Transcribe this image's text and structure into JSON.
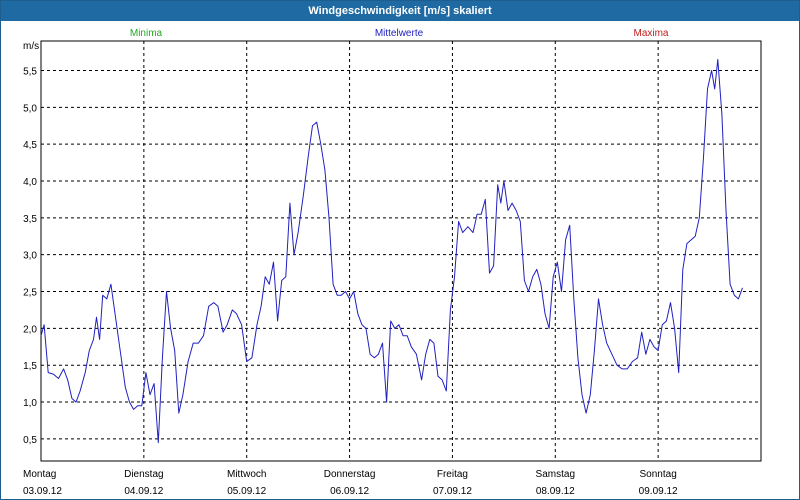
{
  "window": {
    "title": "Windgeschwindigkeit [m/s] skaliert"
  },
  "legend": {
    "min": {
      "label": "Minima",
      "color": "#22aa22"
    },
    "mean": {
      "label": "Mittelwerte",
      "color": "#2020c0"
    },
    "max": {
      "label": "Maxima",
      "color": "#c02020"
    }
  },
  "chart_data": {
    "type": "line",
    "title": "Windgeschwindigkeit [m/s] skaliert",
    "ylabel": "m/s",
    "xlabel": "",
    "ylim": [
      0.2,
      5.9
    ],
    "yticks": [
      "0,5",
      "1,0",
      "1,5",
      "2,0",
      "2,5",
      "3,0",
      "3,5",
      "4,0",
      "4,5",
      "5,0",
      "5,5"
    ],
    "ytick_values": [
      0.5,
      1.0,
      1.5,
      2.0,
      2.5,
      3.0,
      3.5,
      4.0,
      4.5,
      5.0,
      5.5
    ],
    "xlim_days": [
      0,
      7
    ],
    "xticks": [
      {
        "day": "Montag",
        "date": "03.09.12"
      },
      {
        "day": "Dienstag",
        "date": "04.09.12"
      },
      {
        "day": "Mittwoch",
        "date": "05.09.12"
      },
      {
        "day": "Donnerstag",
        "date": "06.09.12"
      },
      {
        "day": "Freitag",
        "date": "07.09.12"
      },
      {
        "day": "Samstag",
        "date": "08.09.12"
      },
      {
        "day": "Sonntag",
        "date": "09.09.12"
      }
    ],
    "grid": true,
    "series": [
      {
        "name": "Mittelwerte",
        "color": "#2020c0",
        "points": [
          [
            0.0,
            1.9
          ],
          [
            0.03,
            2.05
          ],
          [
            0.07,
            1.4
          ],
          [
            0.12,
            1.38
          ],
          [
            0.17,
            1.32
          ],
          [
            0.22,
            1.45
          ],
          [
            0.26,
            1.3
          ],
          [
            0.3,
            1.05
          ],
          [
            0.34,
            1.0
          ],
          [
            0.38,
            1.15
          ],
          [
            0.43,
            1.4
          ],
          [
            0.47,
            1.7
          ],
          [
            0.51,
            1.85
          ],
          [
            0.54,
            2.15
          ],
          [
            0.57,
            1.85
          ],
          [
            0.6,
            2.45
          ],
          [
            0.64,
            2.4
          ],
          [
            0.68,
            2.6
          ],
          [
            0.71,
            2.3
          ],
          [
            0.75,
            1.9
          ],
          [
            0.78,
            1.6
          ],
          [
            0.82,
            1.2
          ],
          [
            0.86,
            1.0
          ],
          [
            0.9,
            0.9
          ],
          [
            0.94,
            0.95
          ],
          [
            0.98,
            0.95
          ],
          [
            1.02,
            1.4
          ],
          [
            1.06,
            1.1
          ],
          [
            1.1,
            1.25
          ],
          [
            1.14,
            0.45
          ],
          [
            1.18,
            1.6
          ],
          [
            1.22,
            2.5
          ],
          [
            1.26,
            2.0
          ],
          [
            1.3,
            1.7
          ],
          [
            1.34,
            0.85
          ],
          [
            1.38,
            1.1
          ],
          [
            1.43,
            1.55
          ],
          [
            1.48,
            1.8
          ],
          [
            1.53,
            1.8
          ],
          [
            1.58,
            1.9
          ],
          [
            1.63,
            2.3
          ],
          [
            1.68,
            2.35
          ],
          [
            1.72,
            2.3
          ],
          [
            1.77,
            1.95
          ],
          [
            1.81,
            2.05
          ],
          [
            1.86,
            2.25
          ],
          [
            1.9,
            2.2
          ],
          [
            1.95,
            2.05
          ],
          [
            2.0,
            1.55
          ],
          [
            2.05,
            1.6
          ],
          [
            2.1,
            2.05
          ],
          [
            2.14,
            2.3
          ],
          [
            2.18,
            2.7
          ],
          [
            2.22,
            2.6
          ],
          [
            2.26,
            2.9
          ],
          [
            2.3,
            2.1
          ],
          [
            2.34,
            2.65
          ],
          [
            2.38,
            2.7
          ],
          [
            2.42,
            3.7
          ],
          [
            2.46,
            3.0
          ],
          [
            2.5,
            3.3
          ],
          [
            2.55,
            3.8
          ],
          [
            2.6,
            4.35
          ],
          [
            2.64,
            4.75
          ],
          [
            2.68,
            4.8
          ],
          [
            2.72,
            4.5
          ],
          [
            2.76,
            4.15
          ],
          [
            2.8,
            3.5
          ],
          [
            2.84,
            2.6
          ],
          [
            2.88,
            2.45
          ],
          [
            2.92,
            2.45
          ],
          [
            2.96,
            2.5
          ],
          [
            3.0,
            2.4
          ],
          [
            3.04,
            2.5
          ],
          [
            3.08,
            2.2
          ],
          [
            3.12,
            2.05
          ],
          [
            3.16,
            2.0
          ],
          [
            3.2,
            1.65
          ],
          [
            3.24,
            1.6
          ],
          [
            3.28,
            1.65
          ],
          [
            3.32,
            1.8
          ],
          [
            3.36,
            1.0
          ],
          [
            3.4,
            2.1
          ],
          [
            3.44,
            2.0
          ],
          [
            3.48,
            2.05
          ],
          [
            3.52,
            1.9
          ],
          [
            3.56,
            1.9
          ],
          [
            3.6,
            1.75
          ],
          [
            3.65,
            1.65
          ],
          [
            3.7,
            1.3
          ],
          [
            3.74,
            1.65
          ],
          [
            3.78,
            1.85
          ],
          [
            3.82,
            1.8
          ],
          [
            3.86,
            1.35
          ],
          [
            3.9,
            1.3
          ],
          [
            3.94,
            1.15
          ],
          [
            3.98,
            2.25
          ],
          [
            4.02,
            2.7
          ],
          [
            4.06,
            3.45
          ],
          [
            4.1,
            3.3
          ],
          [
            4.15,
            3.38
          ],
          [
            4.2,
            3.3
          ],
          [
            4.24,
            3.55
          ],
          [
            4.28,
            3.55
          ],
          [
            4.32,
            3.75
          ],
          [
            4.36,
            2.75
          ],
          [
            4.4,
            2.85
          ],
          [
            4.44,
            3.95
          ],
          [
            4.47,
            3.7
          ],
          [
            4.5,
            4.0
          ],
          [
            4.54,
            3.6
          ],
          [
            4.58,
            3.7
          ],
          [
            4.62,
            3.6
          ],
          [
            4.66,
            3.45
          ],
          [
            4.7,
            2.65
          ],
          [
            4.74,
            2.5
          ],
          [
            4.78,
            2.7
          ],
          [
            4.82,
            2.8
          ],
          [
            4.86,
            2.6
          ],
          [
            4.9,
            2.2
          ],
          [
            4.94,
            2.0
          ],
          [
            4.98,
            2.7
          ],
          [
            5.02,
            2.9
          ],
          [
            5.06,
            2.5
          ],
          [
            5.1,
            3.2
          ],
          [
            5.14,
            3.4
          ],
          [
            5.18,
            2.4
          ],
          [
            5.22,
            1.6
          ],
          [
            5.26,
            1.1
          ],
          [
            5.3,
            0.85
          ],
          [
            5.34,
            1.1
          ],
          [
            5.38,
            1.7
          ],
          [
            5.42,
            2.4
          ],
          [
            5.46,
            2.05
          ],
          [
            5.5,
            1.8
          ],
          [
            5.55,
            1.65
          ],
          [
            5.6,
            1.5
          ],
          [
            5.65,
            1.45
          ],
          [
            5.7,
            1.45
          ],
          [
            5.75,
            1.55
          ],
          [
            5.8,
            1.6
          ],
          [
            5.84,
            1.95
          ],
          [
            5.88,
            1.65
          ],
          [
            5.92,
            1.85
          ],
          [
            5.96,
            1.75
          ],
          [
            6.0,
            1.7
          ],
          [
            6.04,
            2.05
          ],
          [
            6.08,
            2.1
          ],
          [
            6.12,
            2.35
          ],
          [
            6.16,
            2.0
          ],
          [
            6.2,
            1.4
          ],
          [
            6.24,
            2.8
          ],
          [
            6.28,
            3.15
          ],
          [
            6.32,
            3.2
          ],
          [
            6.36,
            3.25
          ],
          [
            6.4,
            3.5
          ],
          [
            6.44,
            4.3
          ],
          [
            6.48,
            5.25
          ],
          [
            6.52,
            5.5
          ],
          [
            6.55,
            5.25
          ],
          [
            6.58,
            5.65
          ],
          [
            6.62,
            4.9
          ],
          [
            6.66,
            3.6
          ],
          [
            6.7,
            2.6
          ],
          [
            6.74,
            2.45
          ],
          [
            6.78,
            2.4
          ],
          [
            6.82,
            2.55
          ]
        ]
      }
    ]
  }
}
